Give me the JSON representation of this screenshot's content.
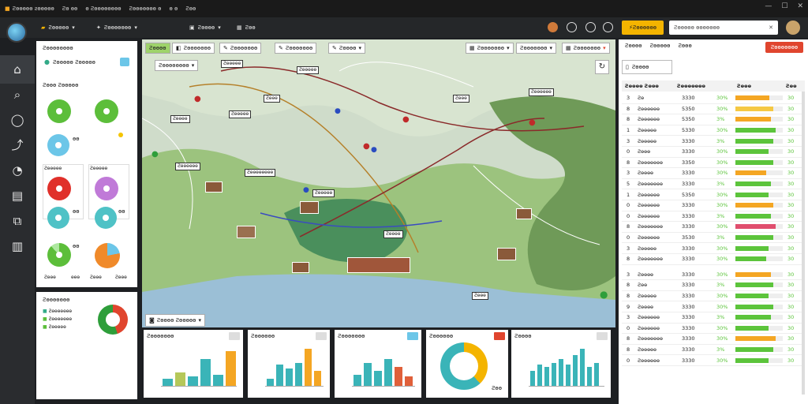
{
  "titlebar": {
    "title": "Ƨɵɵɵɵɵ ƨɵɵɵɵɵ",
    "items": [
      "Ƨɵ ɵɵ",
      "ɵ Ƨɵɵɵɵɵɵɵɵ",
      "Ƨɵɵɵɵɵɵɵ ɵ",
      "ɵ ɵ",
      "Ƨɵɵ"
    ]
  },
  "toolbar": {
    "menu1": "Ƨɵɵɵɵɵ",
    "menu2": "Ƨɵɵɵɵɵɵɵ",
    "menu3": "Ƨɵɵɵɵ",
    "menu4": "Ƨɵɵ",
    "orange_btn": "Ƨɵɵɵɵɵɵ",
    "search_placeholder": "Ƨɵɵɵɵɵ ɵɵɵɵɵɵɵ"
  },
  "left": {
    "title": "Ƨɵɵɵɵɵɵɵɵ",
    "subtitle": "Ƨɵɵɵɵɵ Ƨɵɵɵɵɵ",
    "donut_labels": [
      "ɵɵ",
      "Ƨɵɵɵ Ƨɵɵɵɵɵ",
      "Ƨɵɵɵɵɵ",
      "ɵɵ",
      "ɵɵ",
      "ɵɵ",
      "Ƨɵɵɵ",
      "ɵɵɵ",
      "Ƨɵɵɵ",
      "Ƨɵɵɵ"
    ],
    "legend_title": "Ƨɵɵɵɵɵɵɵ",
    "legend_items": [
      "Ƨɵɵɵɵɵɵɵ",
      "Ƨɵɵɵɵɵɵɵ",
      "Ƨɵɵɵɵɵ"
    ]
  },
  "map": {
    "tabs": [
      "Ƨɵɵɵɵ",
      "Ƨɵɵɵɵɵɵɵ",
      "Ƨɵɵɵɵɵɵɵ",
      "Ƨɵɵɵɵɵɵɵ",
      "Ƨɵɵɵɵ"
    ],
    "right_tabs": [
      "Ƨɵɵɵɵɵɵɵ",
      "Ƨɵɵɵɵɵɵɵ",
      "Ƨɵɵɵɵɵɵɵ"
    ],
    "dropdown": "Ƨɵɵɵɵɵɵɵɵ",
    "labels": [
      "Ƨɵɵɵɵɵ",
      "Ƨɵɵɵɵɵ",
      "Ƨɵɵɵ",
      "Ƨɵɵɵɵ",
      "Ƨɵɵɵɵɵ",
      "Ƨɵɵɵɵɵɵ",
      "Ƨɵɵɵɵɵɵɵɵ",
      "Ƨɵɵɵɵɵ",
      "Ƨɵɵɵɵ",
      "Ƨɵɵɵ",
      "Ƨɵɵɵɵɵɵ",
      "Ƨɵɵɵ"
    ],
    "bottom_dropdown": "Ƨɵɵɵɵ Ƨɵɵɵɵɵ"
  },
  "right": {
    "tabs": [
      "Ƨɵɵɵɵ",
      "Ƨɵɵɵɵɵ",
      "Ƨɵɵɵ"
    ],
    "add_btn": "Ƨɵɵɵɵɵɵɵ",
    "subtab": "Ƨɵɵɵɵ",
    "columns": [
      "Ƨɵɵɵɵ Ƨɵɵɵ",
      "Ƨɵɵɵɵɵɵɵ",
      "Ƨɵɵɵ",
      "Ƨɵɵ"
    ],
    "rows": [
      {
        "n": "3",
        "name": "Ƨɵ",
        "v": "3330",
        "p": "30%",
        "pct": 0.72,
        "c": "#f4a623",
        "t": "30"
      },
      {
        "n": "8",
        "name": "Ƨɵɵɵɵɵɵ",
        "v": "5350",
        "p": "30%",
        "pct": 0.8,
        "c": "#f5c843",
        "t": "30"
      },
      {
        "n": "8",
        "name": "Ƨɵɵɵɵɵɵ",
        "v": "5350",
        "p": "3%",
        "pct": 0.75,
        "c": "#f4a623",
        "t": "30"
      },
      {
        "n": "1",
        "name": "Ƨɵɵɵɵɵ",
        "v": "5330",
        "p": "30%",
        "pct": 0.85,
        "c": "#5cc43b",
        "t": "30"
      },
      {
        "n": "3",
        "name": "Ƨɵɵɵɵɵ",
        "v": "3330",
        "p": "3%",
        "pct": 0.8,
        "c": "#5cc43b",
        "t": "30"
      },
      {
        "n": "0",
        "name": "Ƨɵɵɵ",
        "v": "3330",
        "p": "30%",
        "pct": 0.7,
        "c": "#5cc43b",
        "t": "30"
      },
      {
        "n": "8",
        "name": "Ƨɵɵɵɵɵɵɵ",
        "v": "3350",
        "p": "30%",
        "pct": 0.8,
        "c": "#5cc43b",
        "t": "30"
      },
      {
        "n": "3",
        "name": "Ƨɵɵɵɵ",
        "v": "3330",
        "p": "30%",
        "pct": 0.65,
        "c": "#f4a623",
        "t": "30"
      },
      {
        "n": "5",
        "name": "Ƨɵɵɵɵɵɵɵ",
        "v": "3330",
        "p": "3%",
        "pct": 0.75,
        "c": "#5cc43b",
        "t": "30"
      },
      {
        "n": "1",
        "name": "Ƨɵɵɵɵɵɵ",
        "v": "5350",
        "p": "30%",
        "pct": 0.7,
        "c": "#5cc43b",
        "t": "30"
      },
      {
        "n": "0",
        "name": "Ƨɵɵɵɵɵɵ",
        "v": "3330",
        "p": "30%",
        "pct": 0.8,
        "c": "#f4a623",
        "t": "30"
      },
      {
        "n": "0",
        "name": "Ƨɵɵɵɵɵɵ",
        "v": "3330",
        "p": "3%",
        "pct": 0.75,
        "c": "#5cc43b",
        "t": "30"
      },
      {
        "n": "8",
        "name": "Ƨɵɵɵɵɵɵɵ",
        "v": "3330",
        "p": "30%",
        "pct": 0.85,
        "c": "#e04e6e",
        "t": "30"
      },
      {
        "n": "0",
        "name": "Ƨɵɵɵɵɵɵ",
        "v": "3530",
        "p": "3%",
        "pct": 0.8,
        "c": "#5cc43b",
        "t": "30"
      },
      {
        "n": "3",
        "name": "Ƨɵɵɵɵɵ",
        "v": "3330",
        "p": "30%",
        "pct": 0.7,
        "c": "#5cc43b",
        "t": "30"
      },
      {
        "n": "8",
        "name": "Ƨɵɵɵɵɵɵɵ",
        "v": "3330",
        "p": "30%",
        "pct": 0.65,
        "c": "#5cc43b",
        "t": "30"
      },
      {
        "n": "3",
        "name": "Ƨɵɵɵɵ",
        "v": "3330",
        "p": "30%",
        "pct": 0.75,
        "c": "#f4a623",
        "t": "30"
      },
      {
        "n": "8",
        "name": "Ƨɵɵ",
        "v": "3330",
        "p": "3%",
        "pct": 0.8,
        "c": "#5cc43b",
        "t": "30"
      },
      {
        "n": "8",
        "name": "Ƨɵɵɵɵɵ",
        "v": "3330",
        "p": "30%",
        "pct": 0.7,
        "c": "#5cc43b",
        "t": "30"
      },
      {
        "n": "9",
        "name": "Ƨɵɵɵɵ",
        "v": "3330",
        "p": "30%",
        "pct": 0.8,
        "c": "#5cc43b",
        "t": "30"
      },
      {
        "n": "3",
        "name": "Ƨɵɵɵɵɵɵ",
        "v": "3330",
        "p": "3%",
        "pct": 0.75,
        "c": "#5cc43b",
        "t": "30"
      },
      {
        "n": "0",
        "name": "Ƨɵɵɵɵɵɵ",
        "v": "3330",
        "p": "30%",
        "pct": 0.7,
        "c": "#5cc43b",
        "t": "30"
      },
      {
        "n": "8",
        "name": "Ƨɵɵɵɵɵɵɵ",
        "v": "3330",
        "p": "30%",
        "pct": 0.85,
        "c": "#f4a623",
        "t": "30"
      },
      {
        "n": "8",
        "name": "Ƨɵɵɵɵɵ",
        "v": "3330",
        "p": "3%",
        "pct": 0.8,
        "c": "#5cc43b",
        "t": "30"
      },
      {
        "n": "0",
        "name": "Ƨɵɵɵɵɵɵ",
        "v": "3330",
        "p": "30%",
        "pct": 0.7,
        "c": "#5cc43b",
        "t": "30"
      }
    ]
  },
  "bottom": {
    "panels": [
      {
        "title": "Ƨɵɵɵɵɵɵɵ",
        "bars": [
          0.2,
          0.35,
          0.25,
          0.7,
          0.3,
          0.9
        ],
        "colors": [
          "#3ab4b8",
          "#b5c85a",
          "#3ab4b8",
          "#3ab4b8",
          "#3ab4b8",
          "#f4a623"
        ]
      },
      {
        "title": "Ƨɵɵɵɵɵɵ",
        "bars": [
          0.2,
          0.55,
          0.45,
          0.6,
          0.95,
          0.4
        ],
        "colors": [
          "#3ab4b8",
          "#3ab4b8",
          "#3ab4b8",
          "#3ab4b8",
          "#f4a623",
          "#f4a623"
        ]
      },
      {
        "title": "Ƨɵɵɵɵɵɵɵ",
        "bars": [
          0.3,
          0.6,
          0.4,
          0.7,
          0.5,
          0.25
        ],
        "colors": [
          "#3ab4b8",
          "#3ab4b8",
          "#3ab4b8",
          "#3ab4b8",
          "#e0603a",
          "#e0603a"
        ]
      },
      {
        "title": "Ƨɵɵɵɵɵɵ",
        "donut_label": "Ƨɵɵ"
      },
      {
        "title": "Ƨɵɵɵɵ",
        "bars": [
          0.4,
          0.55,
          0.5,
          0.6,
          0.7,
          0.55,
          0.8,
          0.95,
          0.5,
          0.6
        ],
        "colors": [
          "#3ab4b8"
        ]
      }
    ]
  },
  "colors": {
    "accent_orange": "#f4b400",
    "add_red": "#e0452e",
    "teal": "#3ab4b8",
    "green": "#5cc43b"
  }
}
